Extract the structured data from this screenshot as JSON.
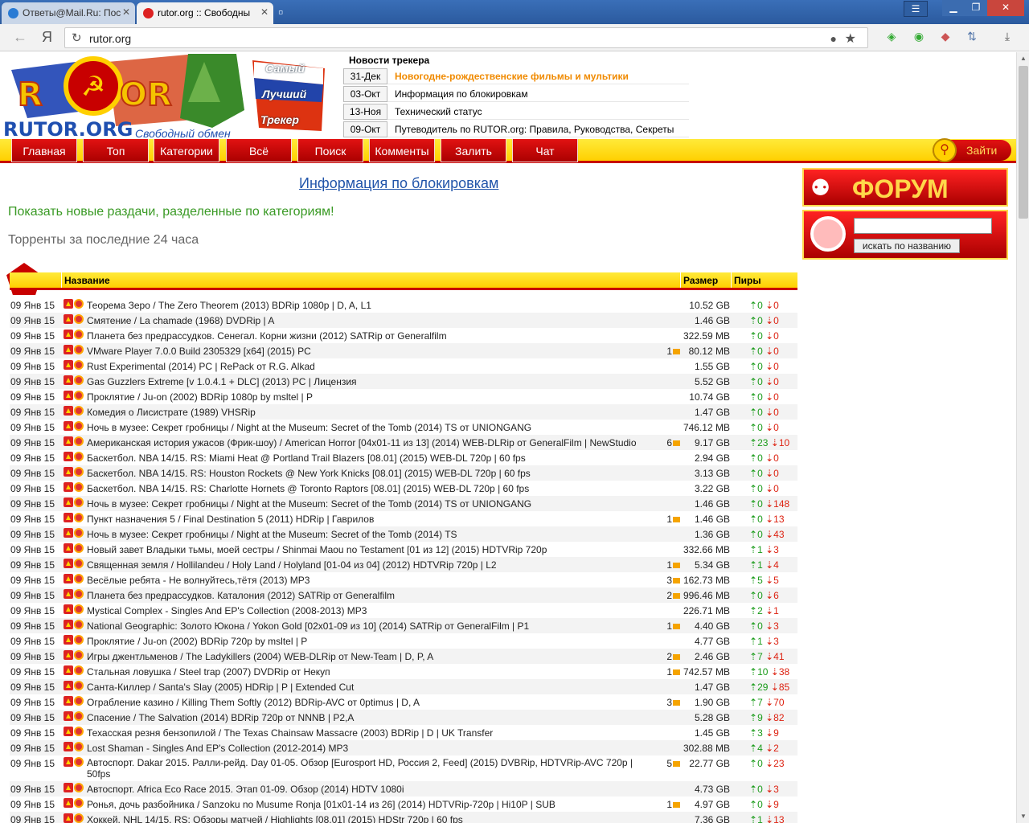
{
  "browser": {
    "tabs": [
      {
        "title": "Ответы@Mail.Ru: Пос"
      },
      {
        "title": "rutor.org :: Свободны"
      }
    ],
    "url": "rutor.org",
    "yandex_label": "Я"
  },
  "logo": {
    "text": "RUTOR.ORG",
    "subtitle": "Свободный обмен",
    "r": "R",
    "or": "OR",
    "slogan1": "Самый",
    "slogan2": "Лучший",
    "slogan3": "Трекер"
  },
  "news": {
    "title": "Новости трекера",
    "items": [
      {
        "date": "31-Дек",
        "text": "Новогодне-рождественские фильмы и мультики",
        "hot": true
      },
      {
        "date": "03-Окт",
        "text": "Информация по блокировкам"
      },
      {
        "date": "13-Ноя",
        "text": "Технический статус"
      },
      {
        "date": "09-Окт",
        "text": "Путеводитель по RUTOR.org: Правила, Руководства, Секреты"
      }
    ]
  },
  "nav": {
    "items": [
      "Главная",
      "Топ",
      "Категории",
      "Всё",
      "Поиск",
      "Комменты",
      "Залить",
      "Чат"
    ],
    "login": "Зайти"
  },
  "main": {
    "block_link": "Информация по блокировкам",
    "show_new": "Показать новые раздачи, разделенные по категориям!",
    "last24": "Торренты за последние 24 часа"
  },
  "sidebar": {
    "forum": "ФОРУМ",
    "search_button": "искать по названию"
  },
  "table": {
    "badge": "24",
    "headers": {
      "name": "Название",
      "size": "Размер",
      "peers": "Пиры"
    },
    "rows": [
      {
        "date": "09 Янв 15",
        "name": "Теорема Зеро / The Zero Theorem (2013) BDRip 1080p | D, A, L1",
        "com": "",
        "size": "10.52 GB",
        "up": "0",
        "down": "0"
      },
      {
        "date": "09 Янв 15",
        "name": "Смятение / La chamade (1968) DVDRip | A",
        "com": "",
        "size": "1.46 GB",
        "up": "0",
        "down": "0"
      },
      {
        "date": "09 Янв 15",
        "name": "Планета без предрассудков. Сенегал. Корни жизни (2012) SATRip от Generalfilm",
        "com": "",
        "size": "322.59 MB",
        "up": "0",
        "down": "0"
      },
      {
        "date": "09 Янв 15",
        "name": "VMware Player 7.0.0 Build 2305329 [x64] (2015) PC",
        "com": "1",
        "size": "80.12 MB",
        "up": "0",
        "down": "0"
      },
      {
        "date": "09 Янв 15",
        "name": "Rust Experimental (2014) PC | RePack от R.G. Alkad",
        "com": "",
        "size": "1.55 GB",
        "up": "0",
        "down": "0"
      },
      {
        "date": "09 Янв 15",
        "name": "Gas Guzzlers Extreme [v 1.0.4.1 + DLC] (2013) PC | Лицензия",
        "com": "",
        "size": "5.52 GB",
        "up": "0",
        "down": "0"
      },
      {
        "date": "09 Янв 15",
        "name": "Проклятие / Ju-on (2002) BDRip 1080p by msltel | P",
        "com": "",
        "size": "10.74 GB",
        "up": "0",
        "down": "0"
      },
      {
        "date": "09 Янв 15",
        "name": "Комедия о Лисистрате (1989) VHSRip",
        "com": "",
        "size": "1.47 GB",
        "up": "0",
        "down": "0"
      },
      {
        "date": "09 Янв 15",
        "name": "Ночь в музее: Секрет гробницы / Night at the Museum: Secret of the Tomb (2014) TS от UNIONGANG",
        "com": "",
        "size": "746.12 MB",
        "up": "0",
        "down": "0"
      },
      {
        "date": "09 Янв 15",
        "name": "Американская история ужасов (Фрик-шоу) / American Horror [04x01-11 из 13] (2014) WEB-DLRip от GeneralFilm | NewStudio",
        "com": "6",
        "size": "9.17 GB",
        "up": "23",
        "down": "10"
      },
      {
        "date": "09 Янв 15",
        "name": "Баскетбол. NBA 14/15. RS: Miami Heat @ Portland Trail Blazers [08.01] (2015) WEB-DL 720p | 60 fps",
        "com": "",
        "size": "2.94 GB",
        "up": "0",
        "down": "0"
      },
      {
        "date": "09 Янв 15",
        "name": "Баскетбол. NBA 14/15. RS: Houston Rockets @ New York Knicks [08.01] (2015) WEB-DL 720p | 60 fps",
        "com": "",
        "size": "3.13 GB",
        "up": "0",
        "down": "0"
      },
      {
        "date": "09 Янв 15",
        "name": "Баскетбол. NBA 14/15. RS: Charlotte Hornets @ Toronto Raptors [08.01] (2015) WEB-DL 720p | 60 fps",
        "com": "",
        "size": "3.22 GB",
        "up": "0",
        "down": "0"
      },
      {
        "date": "09 Янв 15",
        "name": "Ночь в музее: Секрет гробницы / Night at the Museum: Secret of the Tomb (2014) TS от UNIONGANG",
        "com": "",
        "size": "1.46 GB",
        "up": "0",
        "down": "148"
      },
      {
        "date": "09 Янв 15",
        "name": "Пункт назначения 5 / Final Destination 5 (2011) HDRip | Гаврилов",
        "com": "1",
        "size": "1.46 GB",
        "up": "0",
        "down": "13"
      },
      {
        "date": "09 Янв 15",
        "name": "Ночь в музее: Секрет гробницы / Night at the Museum: Secret of the Tomb (2014) TS",
        "com": "",
        "size": "1.36 GB",
        "up": "0",
        "down": "43"
      },
      {
        "date": "09 Янв 15",
        "name": "Новый завет Владыки тьмы, моей сестры / Shinmai Maou no Testament [01 из 12] (2015) HDTVRip 720p",
        "com": "",
        "size": "332.66 MB",
        "up": "1",
        "down": "3"
      },
      {
        "date": "09 Янв 15",
        "name": "Священная земля / Hollilandeu / Holy Land / Holyland [01-04 из 04] (2012) HDTVRip 720p | L2",
        "com": "1",
        "size": "5.34 GB",
        "up": "1",
        "down": "4"
      },
      {
        "date": "09 Янв 15",
        "name": "Весёлые ребята - Не волнуйтесь,тётя (2013) MP3",
        "com": "3",
        "size": "162.73 MB",
        "up": "5",
        "down": "5"
      },
      {
        "date": "09 Янв 15",
        "name": "Планета без предрассудков. Каталония (2012) SATRip от Generalfilm",
        "com": "2",
        "size": "996.46 MB",
        "up": "0",
        "down": "6"
      },
      {
        "date": "09 Янв 15",
        "name": "Mystical Complex - Singles And EP's Collection (2008-2013) MP3",
        "com": "",
        "size": "226.71 MB",
        "up": "2",
        "down": "1"
      },
      {
        "date": "09 Янв 15",
        "name": "National Geographic: Золото Юкона / Yokon Gold [02x01-09 из 10] (2014) SATRip от GeneralFilm | P1",
        "com": "1",
        "size": "4.40 GB",
        "up": "0",
        "down": "3"
      },
      {
        "date": "09 Янв 15",
        "name": "Проклятие / Ju-on (2002) BDRip 720p by msltel | P",
        "com": "",
        "size": "4.77 GB",
        "up": "1",
        "down": "3"
      },
      {
        "date": "09 Янв 15",
        "name": "Игры джентльменов / The Ladykillers (2004) WEB-DLRip от New-Team | D, P, A",
        "com": "2",
        "size": "2.46 GB",
        "up": "7",
        "down": "41"
      },
      {
        "date": "09 Янв 15",
        "name": "Стальная ловушка / Steel trap (2007) DVDRip от Некуп",
        "com": "1",
        "size": "742.57 MB",
        "up": "10",
        "down": "38"
      },
      {
        "date": "09 Янв 15",
        "name": "Санта-Киллер / Santa's Slay (2005) HDRip | P | Extended Cut",
        "com": "",
        "size": "1.47 GB",
        "up": "29",
        "down": "85"
      },
      {
        "date": "09 Янв 15",
        "name": "Ограбление казино / Killing Them Softly (2012) BDRip-AVC от 0ptimus | D, A",
        "com": "3",
        "size": "1.90 GB",
        "up": "7",
        "down": "70"
      },
      {
        "date": "09 Янв 15",
        "name": "Спасение / The Salvation (2014) BDRip 720p от NNNB | P2,A",
        "com": "",
        "size": "5.28 GB",
        "up": "9",
        "down": "82"
      },
      {
        "date": "09 Янв 15",
        "name": "Техасская резня бензопилой / The Texas Chainsaw Massacre (2003) BDRip | D | UK Transfer",
        "com": "",
        "size": "1.45 GB",
        "up": "3",
        "down": "9"
      },
      {
        "date": "09 Янв 15",
        "name": "Lost Shaman - Singles And EP's Collection (2012-2014) MP3",
        "com": "",
        "size": "302.88 MB",
        "up": "4",
        "down": "2"
      },
      {
        "date": "09 Янв 15",
        "name": "Автоспорт. Dakar 2015. Ралли-рейд. Day 01-05. Обзор [Eurosport HD, Россия 2, Feed] (2015) DVBRip, HDTVRip-AVC 720p | 50fps",
        "com": "5",
        "size": "22.77 GB",
        "up": "0",
        "down": "23",
        "tall": true
      },
      {
        "date": "09 Янв 15",
        "name": "Автоспорт. Africa Eco Race 2015. Этап 01-09. Обзор (2014) HDTV 1080i",
        "com": "",
        "size": "4.73 GB",
        "up": "0",
        "down": "3"
      },
      {
        "date": "09 Янв 15",
        "name": "Ронья, дочь разбойника / Sanzoku no Musume Ronja [01x01-14 из 26] (2014) HDTVRip-720p | Hi10P | SUB",
        "com": "1",
        "size": "4.97 GB",
        "up": "0",
        "down": "9"
      },
      {
        "date": "09 Янв 15",
        "name": "Хоккей. NHL 14/15. RS: Обзоры матчей / Highlights [08.01] (2015) HDStr 720p | 60 fps",
        "com": "",
        "size": "7.36 GB",
        "up": "1",
        "down": "13"
      }
    ]
  },
  "colors": {
    "accent_red": "#c80000",
    "accent_yellow": "#ffd000",
    "seed_green": "#1a9b1a",
    "leech_red": "#dd2211"
  }
}
